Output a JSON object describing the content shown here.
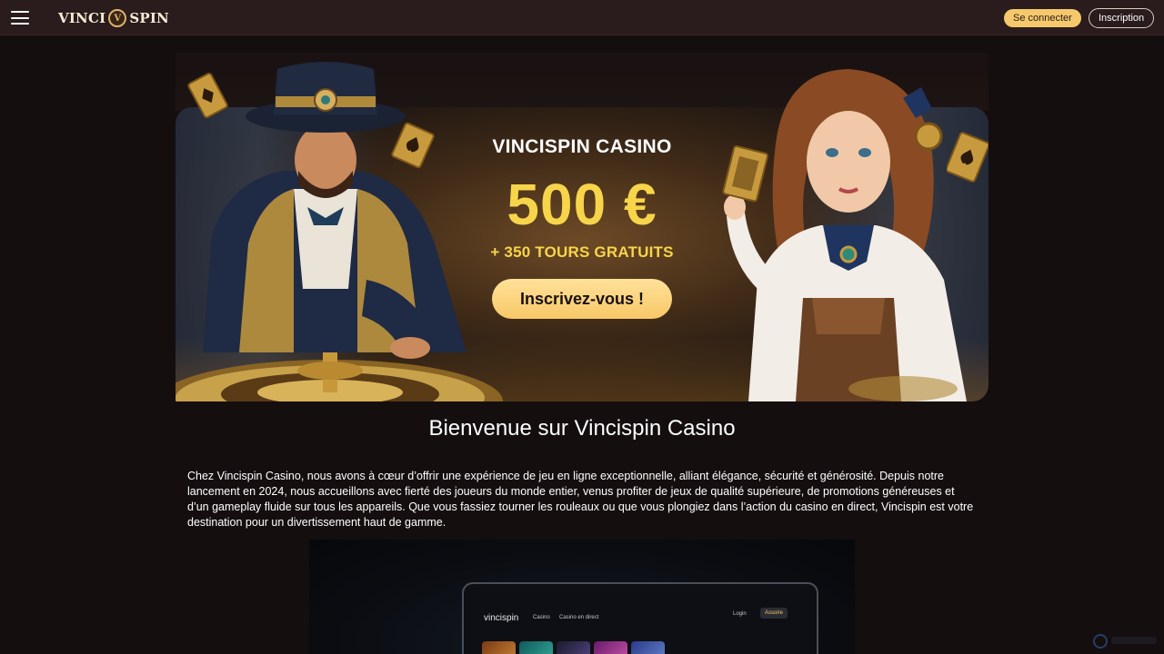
{
  "header": {
    "menu_icon": "hamburger-menu-icon",
    "logo_left": "VINCI",
    "logo_mark": "V",
    "logo_right": "SPIN",
    "login_label": "Se connecter",
    "signup_label": "Inscription",
    "accent": "#f5c96b",
    "background": "#2a1b1c"
  },
  "hero": {
    "title": "VINCISPIN CASINO",
    "amount": "500 €",
    "spins": "+ 350 TOURS GRATUITS",
    "cta_label": "Inscrivez-vous !",
    "amount_color": "#f7d54a"
  },
  "content": {
    "heading": "Bienvenue sur Vincispin Casino",
    "intro": "Chez Vincispin Casino, nous avons à cœur d’offrir une expérience de jeu en ligne exceptionnelle, alliant élégance, sécurité et générosité. Depuis notre lancement en 2024, nous accueillons avec fierté des joueurs du monde entier, venus profiter de jeux de qualité supérieure, de promotions généreuses et d’un gameplay fluide sur tous les appareils. Que vous fassiez tourner les rouleaux ou que vous plongiez dans l’action du casino en direct, Vincispin est votre destination pour un divertissement haut de gamme."
  },
  "promo_image": {
    "logo": "vincispin",
    "nav": [
      "Casino",
      "Casino en direct"
    ],
    "login": "Login",
    "signup": "Assoire"
  }
}
